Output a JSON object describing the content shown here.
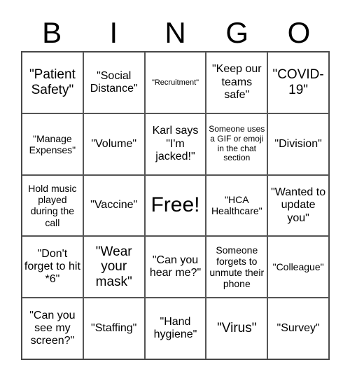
{
  "header": {
    "letters": [
      "B",
      "I",
      "N",
      "G",
      "O"
    ]
  },
  "cells": [
    {
      "text": "\"Patient Safety\"",
      "size": "l"
    },
    {
      "text": "\"Social Distance\"",
      "size": "m"
    },
    {
      "text": "\"Recruitment\"",
      "size": "xxs"
    },
    {
      "text": "\"Keep our teams safe\"",
      "size": "m"
    },
    {
      "text": "\"COVID-19\"",
      "size": "l"
    },
    {
      "text": "\"Manage Expenses\"",
      "size": "s"
    },
    {
      "text": "\"Volume\"",
      "size": "m"
    },
    {
      "text": "Karl says \"I'm jacked!\"",
      "size": "m"
    },
    {
      "text": "Someone uses a GIF or emoji in the chat section",
      "size": "xs"
    },
    {
      "text": "\"Division\"",
      "size": "m"
    },
    {
      "text": "Hold music played during the call",
      "size": "s"
    },
    {
      "text": "\"Vaccine\"",
      "size": "m"
    },
    {
      "text": "Free!",
      "size": "xl"
    },
    {
      "text": "\"HCA Healthcare\"",
      "size": "s"
    },
    {
      "text": "\"Wanted to update you\"",
      "size": "m"
    },
    {
      "text": "\"Don't forget to hit *6\"",
      "size": "m"
    },
    {
      "text": "\"Wear your mask\"",
      "size": "l"
    },
    {
      "text": "\"Can you hear me?\"",
      "size": "m"
    },
    {
      "text": "Someone forgets to unmute their phone",
      "size": "s"
    },
    {
      "text": "\"Colleague\"",
      "size": "s"
    },
    {
      "text": "\"Can you see my screen?\"",
      "size": "m"
    },
    {
      "text": "\"Staffing\"",
      "size": "m"
    },
    {
      "text": "\"Hand hygiene\"",
      "size": "m"
    },
    {
      "text": "\"Virus\"",
      "size": "l"
    },
    {
      "text": "\"Survey\"",
      "size": "m"
    }
  ]
}
